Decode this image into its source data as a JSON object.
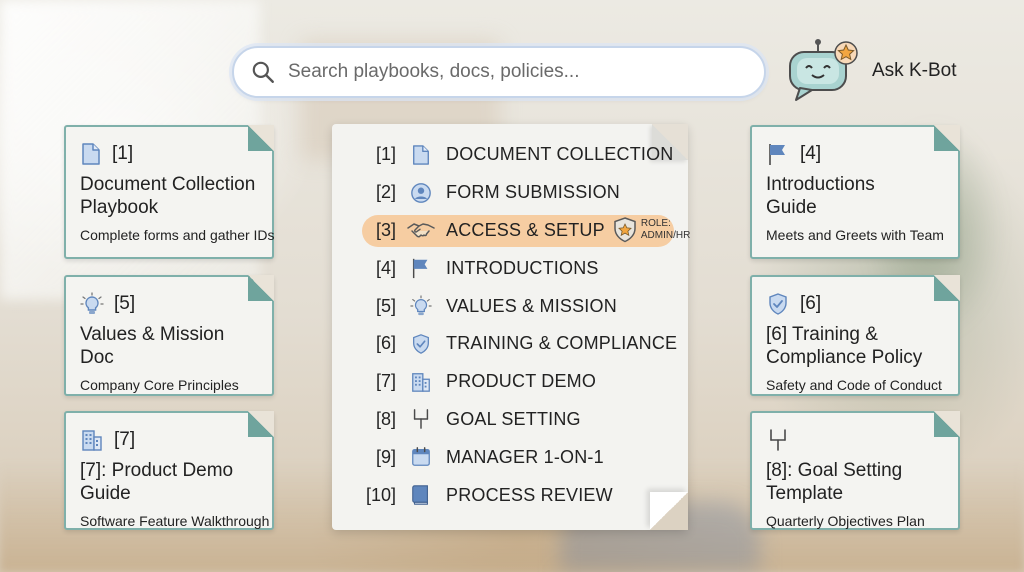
{
  "search": {
    "placeholder": "Search playbooks, docs, policies..."
  },
  "assistant": {
    "label": "Ask K-Bot"
  },
  "cards": {
    "c1": {
      "num": "[1]",
      "title_line1": "Document Collection",
      "title_line2": "Playbook",
      "subtitle": "Complete forms and gather IDs",
      "icon": "document-icon"
    },
    "c5": {
      "num": "[5]",
      "title_line1": "Values & Mission",
      "title_line2": "Doc",
      "subtitle": "Company Core Principles",
      "icon": "lightbulb-icon"
    },
    "c7": {
      "num": "[7]",
      "title_line1": "[7]: Product Demo",
      "title_line2": "Guide",
      "subtitle": "Software Feature Walkthrough",
      "icon": "building-icon"
    },
    "c4": {
      "num": "[4]",
      "title_line1": "Introductions",
      "title_line2": "Guide",
      "subtitle": "Meets and Greets with Team",
      "icon": "flag-icon"
    },
    "c6": {
      "num": "[6]",
      "title_line1": "[6] Training &",
      "title_line2": "Compliance Policy",
      "subtitle": "Safety and Code of Conduct",
      "icon": "shield-icon"
    },
    "c8": {
      "num": "",
      "title_line1": "[8]: Goal Setting",
      "title_line2": "Template",
      "subtitle": "Quarterly Objectives Plan",
      "icon": "goalpost-icon"
    }
  },
  "steps": [
    {
      "idx": "[1]",
      "label": "DOCUMENT COLLECTION",
      "icon": "document-icon"
    },
    {
      "idx": "[2]",
      "label": "FORM SUBMISSION",
      "icon": "user-icon"
    },
    {
      "idx": "[3]",
      "label": "ACCESS & SETUP",
      "icon": "handshake-icon",
      "active": true,
      "role_line1": "ROLE:",
      "role_line2": "ADMIN/HR"
    },
    {
      "idx": "[4]",
      "label": "INTRODUCTIONS",
      "icon": "flag-icon"
    },
    {
      "idx": "[5]",
      "label": "VALUES & MISSION",
      "icon": "lightbulb-icon"
    },
    {
      "idx": "[6]",
      "label": "TRAINING & COMPLIANCE",
      "icon": "shield-icon"
    },
    {
      "idx": "[7]",
      "label": "PRODUCT DEMO",
      "icon": "building-icon"
    },
    {
      "idx": "[8]",
      "label": "GOAL SETTING",
      "icon": "goalpost-icon"
    },
    {
      "idx": "[9]",
      "label": "MANAGER 1-ON-1",
      "icon": "calendar-icon"
    },
    {
      "idx": "[10]",
      "label": "PROCESS REVIEW",
      "icon": "book-icon"
    }
  ],
  "colors": {
    "accent_teal": "#7fb0aa",
    "highlight": "#f6cda2",
    "icon_blue": "#5f86bd"
  }
}
